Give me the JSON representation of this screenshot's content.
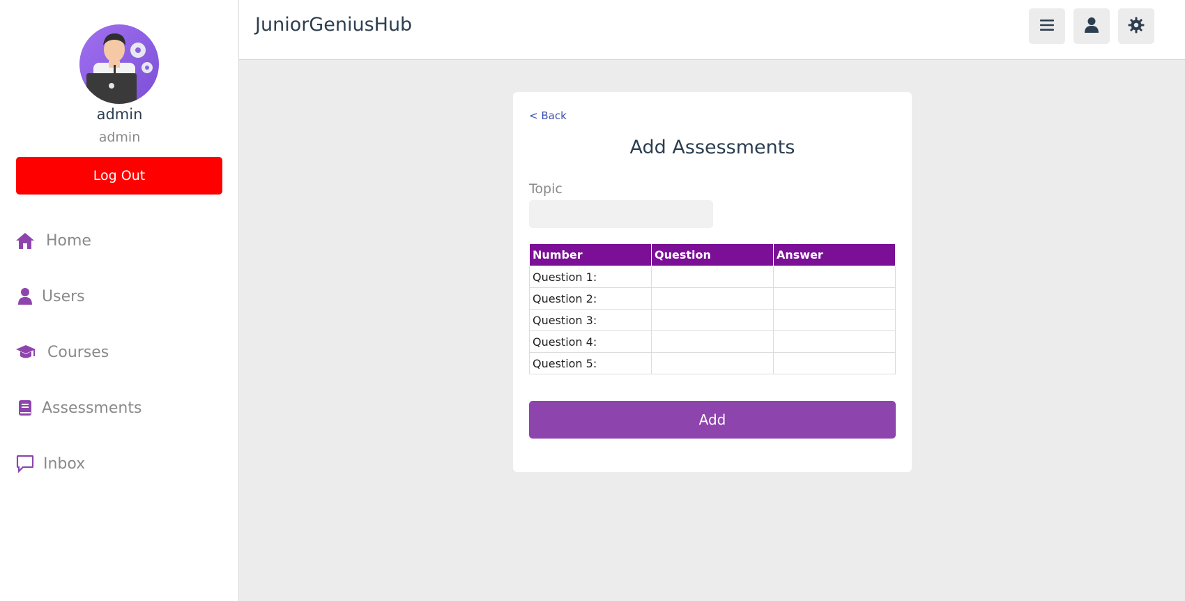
{
  "app": {
    "title": "JuniorGeniusHub"
  },
  "user": {
    "name": "admin",
    "role": "admin",
    "logout_label": "Log Out"
  },
  "sidebar": {
    "items": [
      {
        "label": "Home",
        "icon": "home-icon"
      },
      {
        "label": "Users",
        "icon": "user-icon"
      },
      {
        "label": "Courses",
        "icon": "graduation-cap-icon"
      },
      {
        "label": "Assessments",
        "icon": "book-icon"
      },
      {
        "label": "Inbox",
        "icon": "message-icon"
      }
    ]
  },
  "header": {
    "buttons": [
      "menu-icon",
      "user-icon",
      "settings-icon"
    ]
  },
  "form": {
    "back_label": "< Back",
    "title": "Add Assessments",
    "topic_label": "Topic",
    "topic_value": "",
    "table": {
      "headers": [
        "Number",
        "Question",
        "Answer"
      ],
      "rows": [
        "Question 1:",
        "Question 2:",
        "Question 3:",
        "Question 4:",
        "Question 5:"
      ]
    },
    "submit_label": "Add"
  },
  "colors": {
    "accent": "#8e44ad",
    "table_header": "#7b0f96",
    "logout": "#ff0000",
    "icon_purple": "#8e44ad"
  }
}
